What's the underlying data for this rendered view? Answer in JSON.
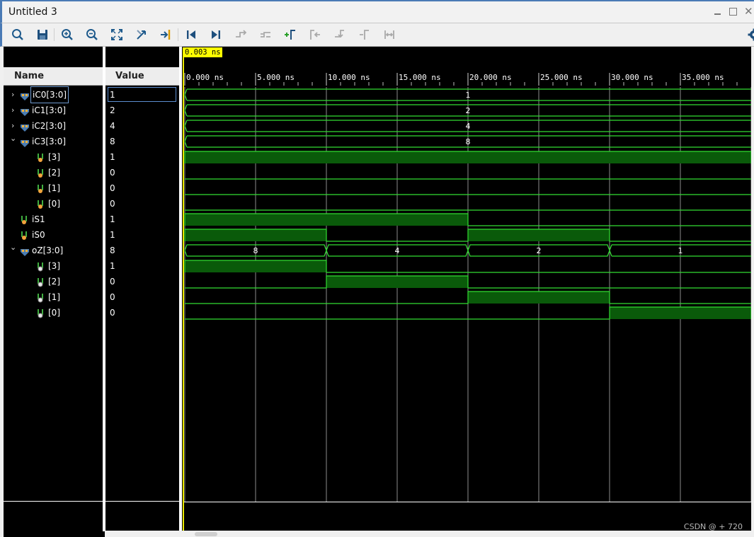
{
  "window": {
    "title": "Untitled 3",
    "controls": [
      "minimize",
      "maximize",
      "close"
    ]
  },
  "toolbar": {
    "buttons": [
      {
        "name": "search-icon",
        "enabled": true
      },
      {
        "name": "save-icon",
        "enabled": true
      },
      {
        "name": "zoom-in-icon",
        "enabled": true
      },
      {
        "name": "zoom-out-icon",
        "enabled": true
      },
      {
        "name": "zoom-fit-icon",
        "enabled": true
      },
      {
        "name": "zoom-to-cursor-icon",
        "enabled": true
      },
      {
        "name": "go-to-time-icon",
        "enabled": true
      },
      {
        "name": "go-to-start-icon",
        "enabled": true
      },
      {
        "name": "go-to-end-icon",
        "enabled": true
      },
      {
        "name": "swap-cursor-icon",
        "enabled": false
      },
      {
        "name": "add-marker-icon",
        "enabled": false
      },
      {
        "name": "previous-transition-icon",
        "enabled": true
      },
      {
        "name": "next-transition-icon",
        "enabled": false
      },
      {
        "name": "previous-marker-icon",
        "enabled": false
      },
      {
        "name": "next-marker-icon",
        "enabled": false
      },
      {
        "name": "delete-marker-icon",
        "enabled": false
      },
      {
        "name": "settings-icon",
        "enabled": true
      }
    ]
  },
  "headers": {
    "name": "Name",
    "value": "Value"
  },
  "cursor": {
    "label": "0.003 ns"
  },
  "timeline": {
    "unit": "ns",
    "ticks": [
      "0.000 ns",
      "5.000 ns",
      "10.000 ns",
      "15.000 ns",
      "20.000 ns",
      "25.000 ns",
      "30.000 ns",
      "35.000 ns"
    ],
    "range_ns": [
      0,
      40
    ]
  },
  "signals": [
    {
      "name": "iC0[3:0]",
      "value": "1",
      "kind": "bus",
      "expand": "collapsed",
      "indent": 0,
      "selected": true,
      "segments": [
        {
          "start": 0,
          "end": 40,
          "label": "1"
        }
      ]
    },
    {
      "name": "iC1[3:0]",
      "value": "2",
      "kind": "bus",
      "expand": "collapsed",
      "indent": 0,
      "segments": [
        {
          "start": 0,
          "end": 40,
          "label": "2"
        }
      ]
    },
    {
      "name": "iC2[3:0]",
      "value": "4",
      "kind": "bus",
      "expand": "collapsed",
      "indent": 0,
      "segments": [
        {
          "start": 0,
          "end": 40,
          "label": "4"
        }
      ]
    },
    {
      "name": "iC3[3:0]",
      "value": "8",
      "kind": "bus",
      "expand": "expanded",
      "indent": 0,
      "segments": [
        {
          "start": 0,
          "end": 40,
          "label": "8"
        }
      ]
    },
    {
      "name": "[3]",
      "value": "1",
      "kind": "bit-in",
      "indent": 1,
      "high": [
        [
          0,
          40
        ]
      ]
    },
    {
      "name": "[2]",
      "value": "0",
      "kind": "bit-in",
      "indent": 1,
      "high": []
    },
    {
      "name": "[1]",
      "value": "0",
      "kind": "bit-in",
      "indent": 1,
      "high": []
    },
    {
      "name": "[0]",
      "value": "0",
      "kind": "bit-in",
      "indent": 1,
      "high": []
    },
    {
      "name": "iS1",
      "value": "1",
      "kind": "bit-in",
      "indent": 0,
      "high": [
        [
          0,
          20
        ]
      ]
    },
    {
      "name": "iS0",
      "value": "1",
      "kind": "bit-in",
      "indent": 0,
      "high": [
        [
          0,
          10
        ],
        [
          20,
          30
        ]
      ]
    },
    {
      "name": "oZ[3:0]",
      "value": "8",
      "kind": "bus",
      "expand": "expanded",
      "indent": 0,
      "segments": [
        {
          "start": 0,
          "end": 10,
          "label": "8"
        },
        {
          "start": 10,
          "end": 20,
          "label": "4"
        },
        {
          "start": 20,
          "end": 30,
          "label": "2"
        },
        {
          "start": 30,
          "end": 40,
          "label": "1"
        }
      ]
    },
    {
      "name": "[3]",
      "value": "1",
      "kind": "bit-out",
      "indent": 1,
      "high": [
        [
          0,
          10
        ]
      ]
    },
    {
      "name": "[2]",
      "value": "0",
      "kind": "bit-out",
      "indent": 1,
      "high": [
        [
          10,
          20
        ]
      ]
    },
    {
      "name": "[1]",
      "value": "0",
      "kind": "bit-out",
      "indent": 1,
      "high": [
        [
          20,
          30
        ]
      ]
    },
    {
      "name": "[0]",
      "value": "0",
      "kind": "bit-out",
      "indent": 1,
      "high": [
        [
          30,
          40
        ]
      ]
    }
  ],
  "colors": {
    "wave": "#32dc32",
    "wave_fill": "#0a5a0a",
    "grid": "#8c8c8c",
    "cursor": "#ffff00"
  },
  "watermark": "CSDN @ + 720"
}
